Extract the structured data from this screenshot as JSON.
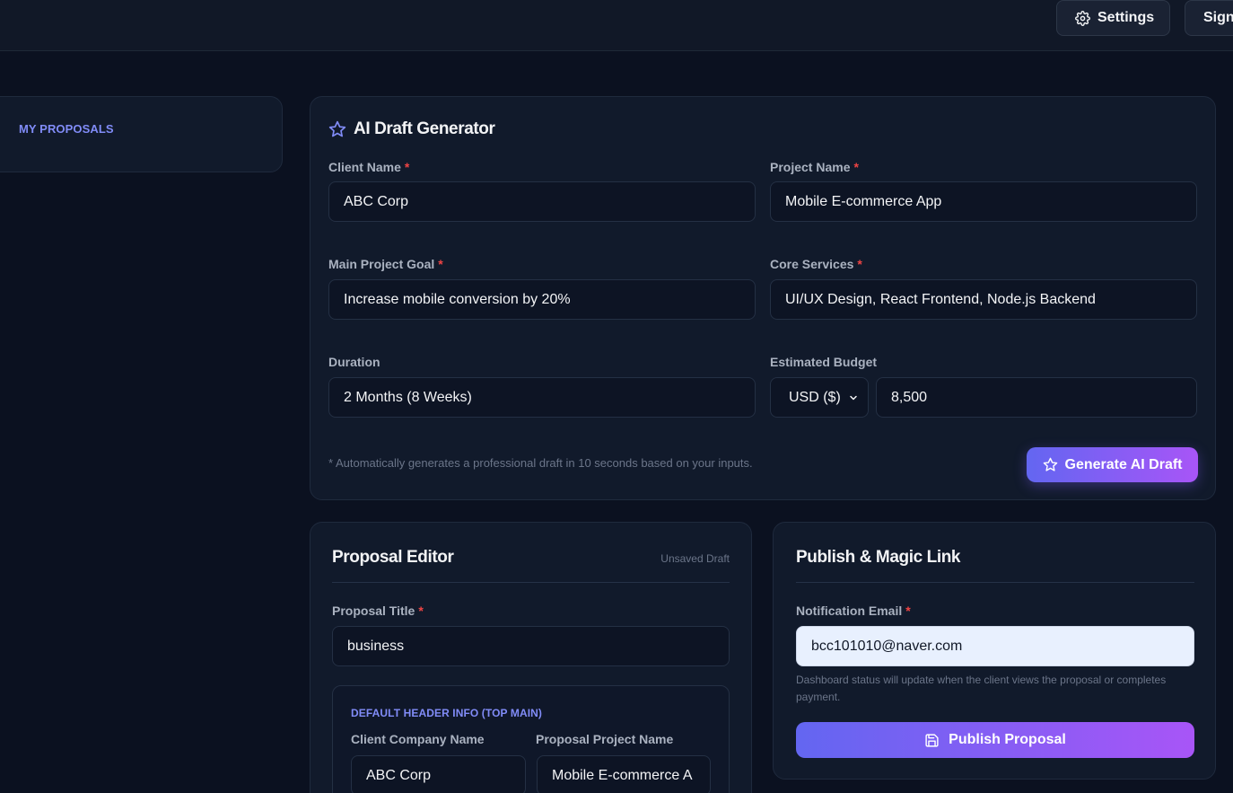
{
  "header": {
    "settings_label": "Settings",
    "sign_label": "Sign"
  },
  "sidebar": {
    "label": "MY PROPOSALS"
  },
  "generator": {
    "title": "AI Draft Generator",
    "client_name": {
      "label": "Client Name",
      "value": "ABC Corp"
    },
    "project_name": {
      "label": "Project Name",
      "value": "Mobile E-commerce App"
    },
    "main_goal": {
      "label": "Main Project Goal",
      "value": "Increase mobile conversion by 20%"
    },
    "core_services": {
      "label": "Core Services",
      "value": "UI/UX Design, React Frontend, Node.js Backend"
    },
    "duration": {
      "label": "Duration",
      "value": "2 Months (8 Weeks)"
    },
    "budget": {
      "label": "Estimated Budget",
      "currency": "USD ($)",
      "value": "8,500"
    },
    "required_mark": "*",
    "hint": "* Automatically generates a professional draft in 10 seconds based on your inputs.",
    "button_label": "Generate AI Draft"
  },
  "editor": {
    "title": "Proposal Editor",
    "status": "Unsaved Draft",
    "proposal_title": {
      "label": "Proposal Title",
      "value": "business"
    },
    "header_info": {
      "heading": "DEFAULT HEADER INFO (TOP MAIN)",
      "company": {
        "label": "Client Company Name",
        "value": "ABC Corp"
      },
      "project": {
        "label": "Proposal Project Name",
        "value": "Mobile E-commerce A"
      }
    }
  },
  "publish": {
    "title": "Publish & Magic Link",
    "email": {
      "label": "Notification Email",
      "value": "bcc101010@naver.com"
    },
    "hint": "Dashboard status will update when the client views the proposal or completes payment.",
    "button_label": "Publish Proposal"
  },
  "colors": {
    "background": "#0b1120",
    "card": "#111a2b",
    "accent": "#818cf8",
    "gradient_start": "#6366f1",
    "gradient_end": "#a855f7",
    "required": "#ef4444"
  }
}
